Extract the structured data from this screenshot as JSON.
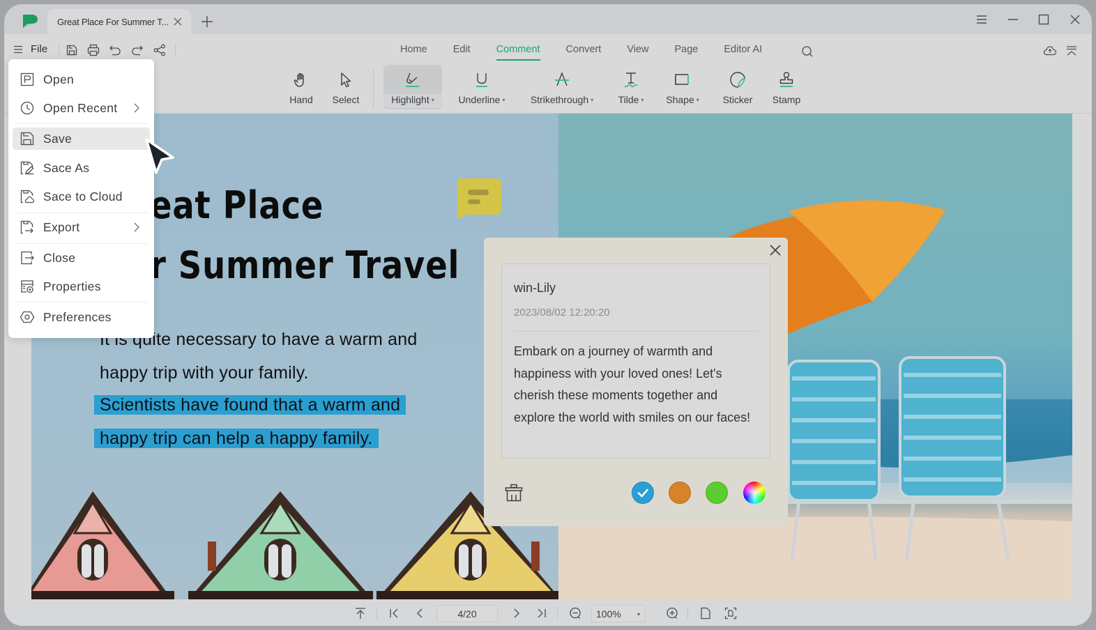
{
  "app": {
    "tab_title": "Great Place For Summer T...",
    "brand_color": "#1aa56d"
  },
  "menubar": {
    "file_label": "File",
    "tabs": [
      {
        "label": "Home",
        "active": false
      },
      {
        "label": "Edit",
        "active": false
      },
      {
        "label": "Comment",
        "active": true
      },
      {
        "label": "Convert",
        "active": false
      },
      {
        "label": "View",
        "active": false
      },
      {
        "label": "Page",
        "active": false
      },
      {
        "label": "Editor AI",
        "active": false
      }
    ]
  },
  "toolbar": {
    "tools": [
      {
        "label": "Hand",
        "icon": "hand-icon",
        "dropdown": false
      },
      {
        "label": "Select",
        "icon": "select-arrow-icon",
        "dropdown": false
      },
      {
        "label": "Highlight",
        "icon": "highlight-icon",
        "dropdown": true,
        "selected": true
      },
      {
        "label": "Underline",
        "icon": "underline-icon",
        "dropdown": true
      },
      {
        "label": "Strikethrough",
        "icon": "strikethrough-icon",
        "dropdown": true
      },
      {
        "label": "Tilde",
        "icon": "tilde-icon",
        "dropdown": true
      },
      {
        "label": "Shape",
        "icon": "shape-icon",
        "dropdown": true
      },
      {
        "label": "Sticker",
        "icon": "sticker-icon",
        "dropdown": false
      },
      {
        "label": "Stamp",
        "icon": "stamp-icon",
        "dropdown": false
      }
    ],
    "caret": "▾"
  },
  "file_menu": {
    "items": [
      {
        "label": "Open",
        "icon": "open-file-icon",
        "submenu": false
      },
      {
        "label": "Open Recent",
        "icon": "clock-icon",
        "submenu": true
      },
      {
        "label": "Save",
        "icon": "save-icon",
        "submenu": false,
        "active": true
      },
      {
        "label": "Sace As",
        "icon": "save-as-icon",
        "submenu": false
      },
      {
        "label": "Sace to Cloud",
        "icon": "save-cloud-icon",
        "submenu": false
      },
      {
        "label": "Export",
        "icon": "export-icon",
        "submenu": true
      },
      {
        "label": "Close",
        "icon": "close-file-icon",
        "submenu": false
      },
      {
        "label": "Properties",
        "icon": "properties-icon",
        "submenu": false
      },
      {
        "label": "Preferences",
        "icon": "preferences-icon",
        "submenu": false
      }
    ]
  },
  "document": {
    "headline_line1": "eat Place",
    "headline_line2": "r Summer Travel",
    "paragraph_line1": "It is quite necessary to have a warm and",
    "paragraph_line2": "happy trip with your family.",
    "highlight_line1": "Scientists have found that a warm and",
    "highlight_line2": "happy trip can help a happy family.",
    "highlight_color": "#2a9fd1"
  },
  "comment": {
    "author": "win-Lily",
    "timestamp": "2023/08/02 12:20:20",
    "text": "Embark on a journey of warmth and happiness with your loved ones! Let's cherish these moments together and explore the world with smiles on our faces!",
    "colors": [
      {
        "name": "blue",
        "hex": "#2a9fd6",
        "selected": true
      },
      {
        "name": "orange",
        "hex": "#d6842a",
        "selected": false
      },
      {
        "name": "green",
        "hex": "#5ccd2f",
        "selected": false
      },
      {
        "name": "custom",
        "hex": "spectrum",
        "selected": false
      }
    ]
  },
  "statusbar": {
    "page_indicator": "4/20",
    "zoom_level": "100%",
    "zoom_caret": "▾"
  }
}
